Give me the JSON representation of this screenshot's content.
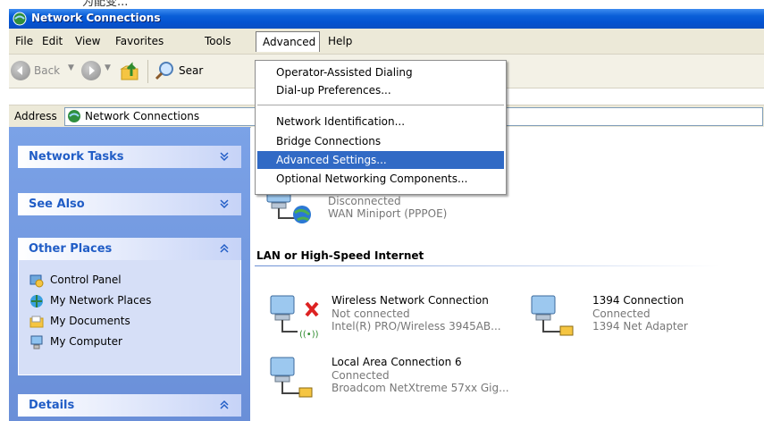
{
  "top_scrap_text": "为配变...",
  "window": {
    "title": "Network Connections"
  },
  "menu": {
    "file": "File",
    "edit": "Edit",
    "view": "View",
    "favorites": "Favorites",
    "tools": "Tools",
    "advanced": "Advanced",
    "help": "Help"
  },
  "toolbar": {
    "back": "Back",
    "search_partial": "Sear"
  },
  "address": {
    "label": "Address",
    "value": "Network Connections"
  },
  "tasks": {
    "network_tasks": "Network Tasks",
    "see_also": "See Also",
    "other_places": "Other Places",
    "details": "Details",
    "places": [
      "Control Panel",
      "My Network Places",
      "My Documents",
      "My Computer"
    ]
  },
  "advanced_menu": {
    "items": [
      "Operator-Assisted Dialing",
      "Dial-up Preferences...",
      "Network Identification...",
      "Bridge Connections",
      "Advanced Settings...",
      "Optional Networking Components..."
    ],
    "selected": "Advanced Settings..."
  },
  "groups": {
    "lan": "LAN or High-Speed Internet"
  },
  "connections": {
    "wan": {
      "status": "Disconnected",
      "device": "WAN Miniport (PPPOE)"
    },
    "wireless": {
      "name": "Wireless Network Connection",
      "status": "Not connected",
      "device": "Intel(R) PRO/Wireless 3945AB..."
    },
    "fw1394": {
      "name": "1394 Connection",
      "status": "Connected",
      "device": "1394 Net Adapter"
    },
    "lan6": {
      "name": "Local Area Connection 6",
      "status": "Connected",
      "device": "Broadcom NetXtreme 57xx Gig..."
    }
  },
  "colors": {
    "titlebar": "#0a5fd8",
    "selection": "#316ac5",
    "taskpane": "#6a8fd8",
    "task_title": "#215dc6"
  }
}
